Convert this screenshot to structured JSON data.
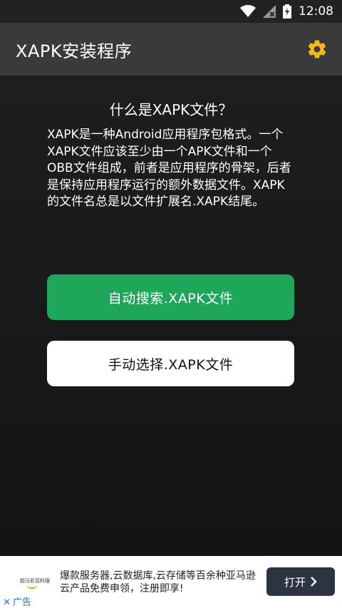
{
  "status": {
    "time": "12:08"
  },
  "app": {
    "title": "XAPK安装程序"
  },
  "info": {
    "heading": "什么是XAPK文件？",
    "description": "XAPK是一种Android应用程序包格式。一个XAPK文件应该至少由一个APK文件和一个OBB文件组成，前者是应用程序的骨架，后者是保持应用程序运行的额外数据文件。XAPK的文件名总是以文件扩展名.XAPK结尾。"
  },
  "buttons": {
    "auto": "自动搜索.XAPK文件",
    "manual": "手动选择.XAPK文件"
  },
  "ad": {
    "logo_text": "超马彩百科搜",
    "text": "爆款服务器,云数据库,云存储等百余种亚马逊云产品免费申领，注册即享!",
    "button": "打开",
    "badge": "广告"
  },
  "colors": {
    "accent_green": "#1ea65a",
    "gear": "#f5b81b"
  }
}
